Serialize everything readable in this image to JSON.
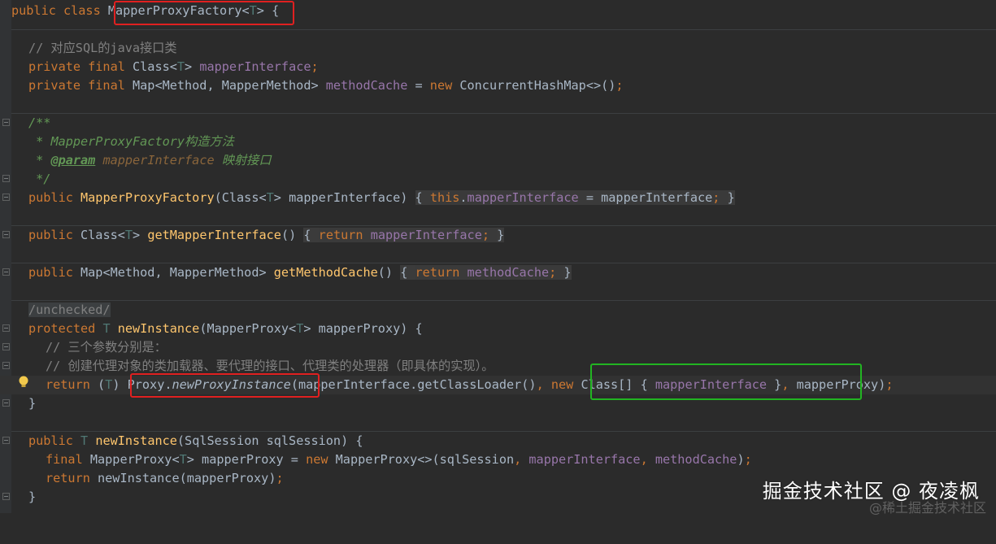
{
  "lines": {
    "l1": {
      "a": "public class ",
      "b": "MapperProxyFactory",
      "c": "<",
      "d": "T",
      "e": "> {"
    },
    "l3": "// 对应SQL的java接口类",
    "l4": {
      "a": "private final ",
      "b": "Class",
      "c": "<",
      "d": "T",
      "e": "> ",
      "f": "mapperInterface",
      "g": ";"
    },
    "l5": {
      "a": "private final ",
      "b": "Map<Method, MapperMethod> ",
      "c": "methodCache",
      "d": " = ",
      "e": "new ",
      "f": "ConcurrentHashMap<>()",
      "g": ";"
    },
    "l7": "/**",
    "l8": {
      "a": " * ",
      "b": "MapperProxyFactory构造方法"
    },
    "l9": {
      "a": " * ",
      "b": "@param",
      "c": " mapperInterface",
      "d": " 映射接口"
    },
    "l10": " */",
    "l11": {
      "a": "public ",
      "b": "MapperProxyFactory",
      "c": "(Class<",
      "d": "T",
      "e": "> mapperInterface) ",
      "f": "{ ",
      "g": "this",
      "h": ".",
      "i": "mapperInterface",
      "j": " = mapperInterface",
      "k": "; ",
      "l": "}"
    },
    "l13": {
      "a": "public ",
      "b": "Class<",
      "c": "T",
      "d": "> ",
      "e": "getMapperInterface",
      "f": "() ",
      "g": "{ ",
      "h": "return ",
      "i": "mapperInterface",
      "j": "; ",
      "k": "}"
    },
    "l15": {
      "a": "public ",
      "b": "Map<Method, MapperMethod> ",
      "c": "getMethodCache",
      "d": "() ",
      "e": "{ ",
      "f": "return ",
      "g": "methodCache",
      "h": "; ",
      "i": "}"
    },
    "l17": "/unchecked/",
    "l18": {
      "a": "protected ",
      "b": "T ",
      "c": "newInstance",
      "d": "(MapperProxy<",
      "e": "T",
      "f": "> mapperProxy) {"
    },
    "l19": "// 三个参数分别是：",
    "l20": "// 创建代理对象的类加载器、要代理的接口、代理类的处理器（即具体的实现）。",
    "l21": {
      "a": "return ",
      "b": "(",
      "c": "T",
      "d": ") ",
      "e": "Proxy.",
      "f": "newProxyInstance",
      "g": "(mapperInterface.getClassLoader()",
      "h": ", ",
      "i": "new ",
      "j": "Class[] { ",
      "k": "mapperInterface",
      "l": " }",
      "m": ", ",
      "n": "mapperProxy)",
      "o": ";"
    },
    "l22": "}",
    "l24": {
      "a": "public ",
      "b": "T ",
      "c": "newInstance",
      "d": "(SqlSession sqlSession) {"
    },
    "l25": {
      "a": "final ",
      "b": "MapperProxy<",
      "c": "T",
      "d": "> mapperProxy = ",
      "e": "new ",
      "f": "MapperProxy<>(sqlSession",
      "g": ", ",
      "h": "mapperInterface",
      "i": ", ",
      "j": "methodCache",
      "k": ")",
      "l": ";"
    },
    "l26": {
      "a": "return ",
      "b": "newInstance(mapperProxy)",
      "c": ";"
    },
    "l27": "}"
  },
  "watermark": {
    "main": "掘金技术社区 @ 夜凌枫",
    "faint": "@稀土掘金技术社区"
  },
  "colors": {
    "background": "#2b2b2b",
    "keyword": "#cc7832",
    "field": "#9876aa",
    "method": "#ffc66d",
    "type_param": "#507874",
    "comment": "#808080",
    "doc": "#629755",
    "highlight_red": "#e02020",
    "highlight_green": "#22b422"
  }
}
